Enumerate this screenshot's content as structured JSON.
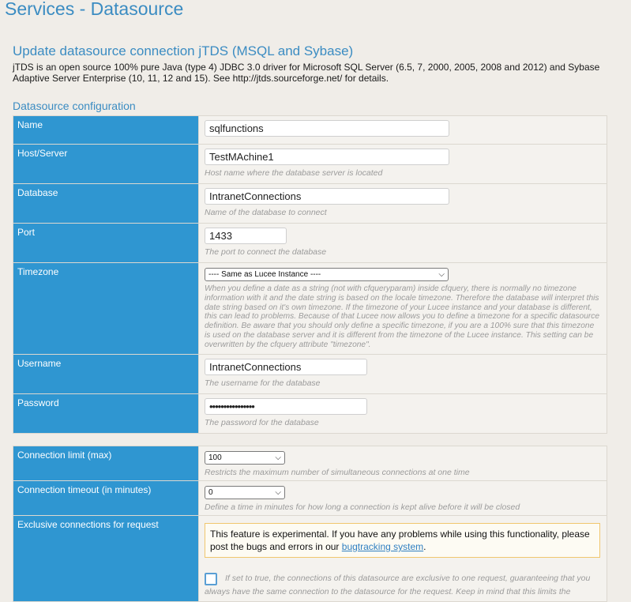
{
  "page": {
    "title": "Services - Datasource",
    "section_title": "Update datasource connection jTDS (MSQL and Sybase)",
    "intro": "jTDS is an open source 100% pure Java (type 4) JDBC 3.0 driver for Microsoft SQL Server (6.5, 7, 2000, 2005, 2008 and 2012) and Sybase Adaptive Server Enterprise (10, 11, 12 and 15). See http://jtds.sourceforge.net/ for details.",
    "config_title": "Datasource configuration"
  },
  "fields": {
    "name": {
      "label": "Name",
      "value": "sqlfunctions"
    },
    "host": {
      "label": "Host/Server",
      "value": "TestMAchine1",
      "hint": "Host name where the database server is located"
    },
    "database": {
      "label": "Database",
      "value": "IntranetConnections",
      "hint": "Name of the database to connect"
    },
    "port": {
      "label": "Port",
      "value": "1433",
      "hint": "The port to connect the database"
    },
    "timezone": {
      "label": "Timezone",
      "selected": "---- Same as Lucee Instance ----",
      "hint": "When you define a date as a string (not with cfqueryparam) inside cfquery, there is normally no timezone information with it and the date string is based on the locale timezone. Therefore the database will interpret this date string based on it's own timezone. If the timezone of your Lucee instance and your database is different, this can lead to problems. Because of that Lucee now allows you to define a timezone for a specific datasource definition. Be aware that you should only define a specific timezone, if you are a 100% sure that this timezone is used on the database server and it is different from the timezone of the Lucee instance. This setting can be overwritten by the cfquery attribute \"timezone\"."
    },
    "username": {
      "label": "Username",
      "value": "IntranetConnections",
      "hint": "The username for the database"
    },
    "password": {
      "label": "Password",
      "value": "••••••••••••••••",
      "hint": "The password for the database"
    }
  },
  "connection": {
    "limit": {
      "label": "Connection limit (max)",
      "selected": "100",
      "hint": "Restricts the maximum number of simultaneous connections at one time"
    },
    "timeout": {
      "label": "Connection timeout (in minutes)",
      "selected": "0",
      "hint": "Define a time in minutes for how long a connection is kept alive before it will be closed"
    },
    "exclusive": {
      "label": "Exclusive connections for request",
      "warning_text": "This feature is experimental. If you have any problems while using this functionality, please post the bugs and errors in our ",
      "warning_link": "bugtracking system",
      "warning_end": ".",
      "checkbox_hint": "If set to true, the connections of this datasource are exclusive to one request, guaranteeing that you always have the same connection to the datasource for the request. Keep in mind that this limits the"
    }
  },
  "colors": {
    "label_bg": "#2f96d1",
    "title": "#3b8cc2",
    "page_bg": "#f0ede8"
  }
}
